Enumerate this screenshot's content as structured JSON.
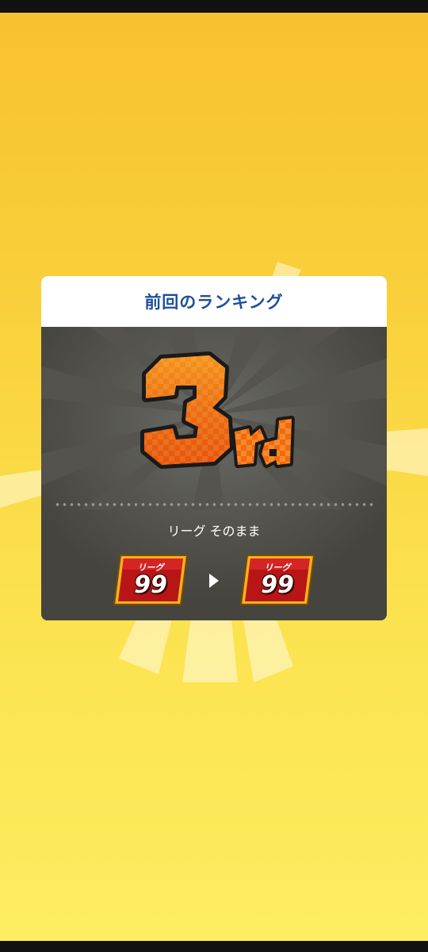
{
  "panel": {
    "title": "前回のランキング",
    "rank_number": "3",
    "rank_suffix": "rd",
    "league_status": "リーグ そのまま"
  },
  "league_before": {
    "label": "リーグ",
    "number": "99"
  },
  "league_after": {
    "label": "リーグ",
    "number": "99"
  },
  "icons": {
    "rank": "rank-3rd-emblem-icon",
    "arrow": "right-arrow-icon"
  },
  "colors": {
    "background_top": "#f7c12e",
    "background_bottom": "#fdee62",
    "title": "#1e4f9c",
    "panel": "#45443e",
    "badge_red": "#b81516",
    "badge_gold": "#f2b21d",
    "rank_orange": "#f06a12"
  }
}
